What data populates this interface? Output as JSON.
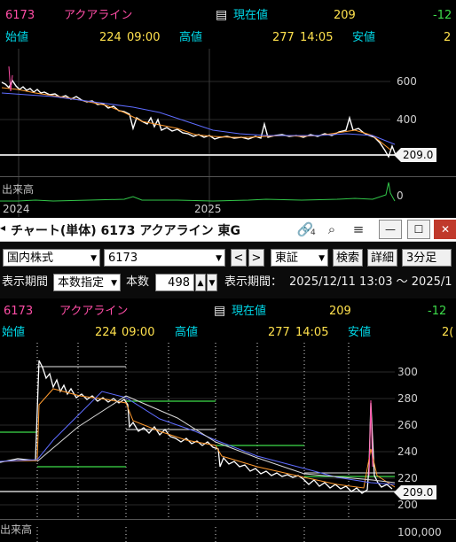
{
  "top_chart": {
    "code": "6173",
    "name": "アクアライン",
    "current_label": "現在値",
    "current_value": "209",
    "change": "-12",
    "open_label": "始値",
    "open_value": "224",
    "open_time": "09:00",
    "high_label": "高値",
    "high_value": "277",
    "high_time": "14:05",
    "low_label": "安値",
    "low_value": "2",
    "price_ticks": [
      "600",
      "400"
    ],
    "price_tag": "209.0",
    "volume_label": "出来高",
    "x_ticks": [
      "2024",
      "2025"
    ],
    "volume_tick": "0"
  },
  "window": {
    "title": "チャート(単体) 6173 アクアライン 東G",
    "link_icon_badge": "4",
    "minimize": "—",
    "maximize": "☐",
    "close": "✕"
  },
  "toolbar": {
    "market": "国内株式",
    "symbol": "6173",
    "prev": "<",
    "next": ">",
    "exchange": "東証",
    "search": "検索",
    "detail": "詳細",
    "interval": "3分足",
    "period_label": "表示期間",
    "period_mode": "本数指定",
    "count_label": "本数",
    "count_value": "498",
    "range_label": "表示期間：",
    "range_value": "2025/12/11 13:03 〜 2025/1"
  },
  "bottom_chart": {
    "code": "6173",
    "name": "アクアライン",
    "current_label": "現在値",
    "current_value": "209",
    "change": "-12",
    "open_label": "始値",
    "open_value": "224",
    "open_time": "09:00",
    "high_label": "高値",
    "high_value": "277",
    "high_time": "14:05",
    "low_label": "安値",
    "low_value": "2(",
    "price_ticks": [
      "300",
      "280",
      "260",
      "240",
      "220",
      "200"
    ],
    "price_tag": "209.0",
    "volume_label": "出来高",
    "volume_tick": "100,000"
  }
}
